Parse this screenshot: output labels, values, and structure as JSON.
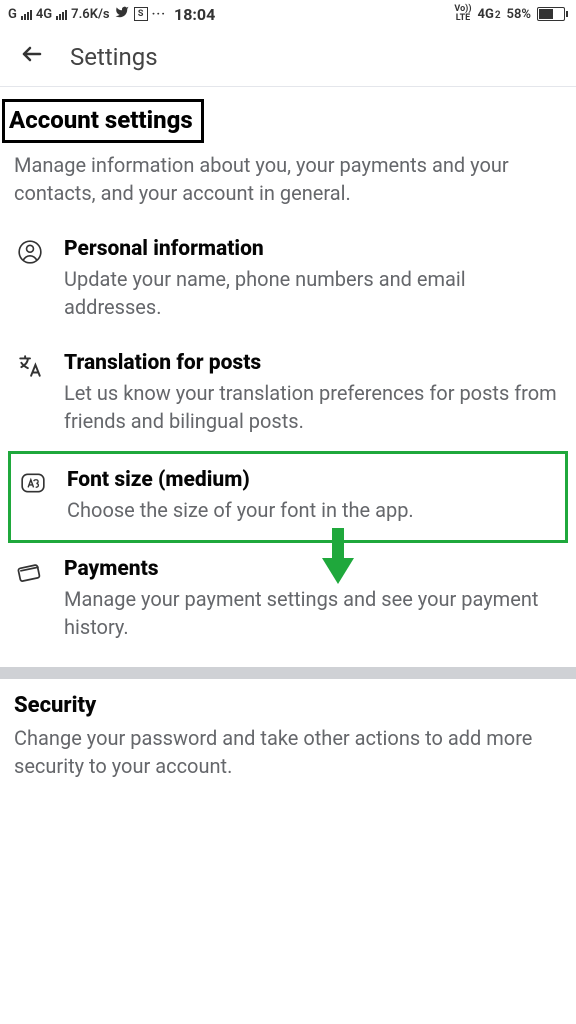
{
  "status_bar": {
    "carrier_g": "G",
    "net_4g": "4G",
    "speed": "7.6K/s",
    "s_label": "S",
    "dots": "···",
    "time": "18:04",
    "volte": "Vo))",
    "lte": "LTE",
    "net_4g2": "4G",
    "sub2": "2",
    "battery_pct": "58%"
  },
  "header": {
    "title": "Settings"
  },
  "account": {
    "heading": "Account settings",
    "desc": "Manage information about you, your payments and your contacts, and your account in general."
  },
  "items": {
    "personal": {
      "title": "Personal information",
      "desc": "Update your name, phone numbers and email addresses."
    },
    "translation": {
      "title": "Translation for posts",
      "desc": "Let us know your translation preferences for posts from friends and bilingual posts."
    },
    "font": {
      "title": "Font size (medium)",
      "desc": "Choose the size of your font in the app."
    },
    "payments": {
      "title": "Payments",
      "desc": "Manage your payment settings and see your payment history."
    }
  },
  "security": {
    "heading": "Security",
    "desc": "Change your password and take other actions to add more security to your account."
  },
  "annotations": {
    "arrow_color": "#1fa83c",
    "highlight_color": "#1fa83c"
  }
}
